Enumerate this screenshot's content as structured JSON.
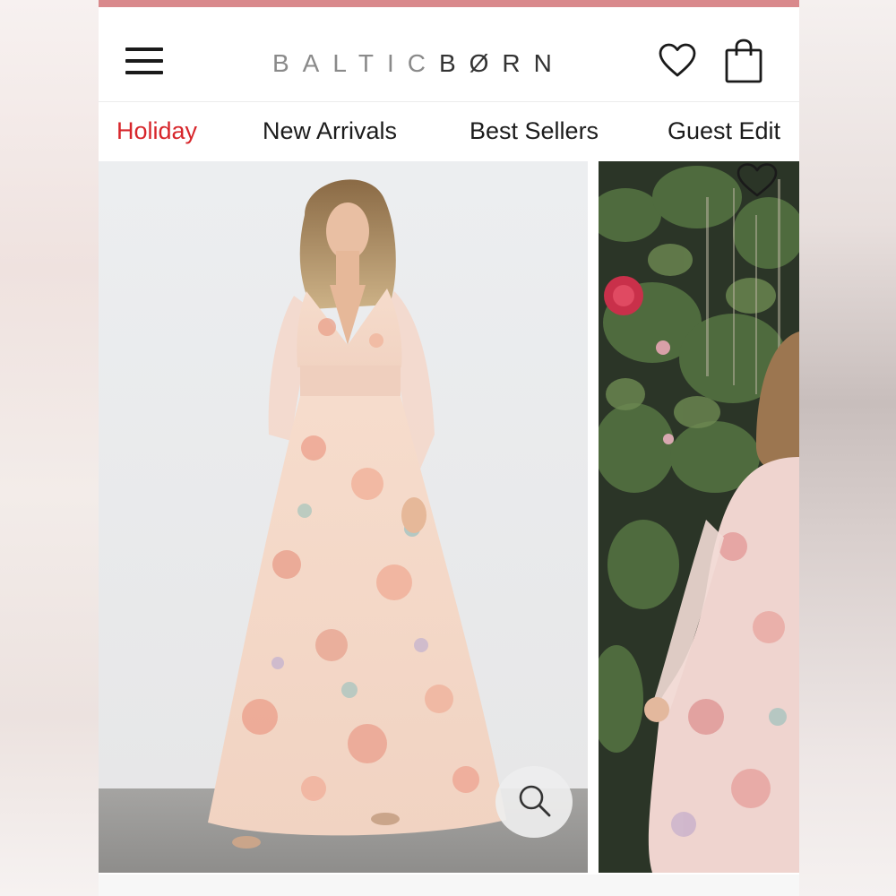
{
  "brand": {
    "logo_part1": "BALTIC",
    "logo_part2": "BØRN",
    "accent_color": "#d9898c",
    "nav_active_color": "#d7262b"
  },
  "header": {
    "menu_icon": "hamburger-menu-icon",
    "wishlist_icon": "heart-icon",
    "cart_icon": "shopping-bag-icon"
  },
  "nav": {
    "items": [
      {
        "label": "Holiday",
        "active": true
      },
      {
        "label": "New Arrivals",
        "active": false
      },
      {
        "label": "Best Sellers",
        "active": false
      },
      {
        "label": "Guest Edit",
        "active": false
      }
    ]
  },
  "gallery": {
    "images": [
      {
        "name": "product-photo-studio",
        "description_icon": "model-floral-maxi-dress"
      },
      {
        "name": "product-photo-garden",
        "description_icon": "model-floral-maxi-dress-outdoor"
      }
    ],
    "zoom_icon": "magnifier-icon",
    "wishlist_icon": "heart-outline-icon"
  }
}
